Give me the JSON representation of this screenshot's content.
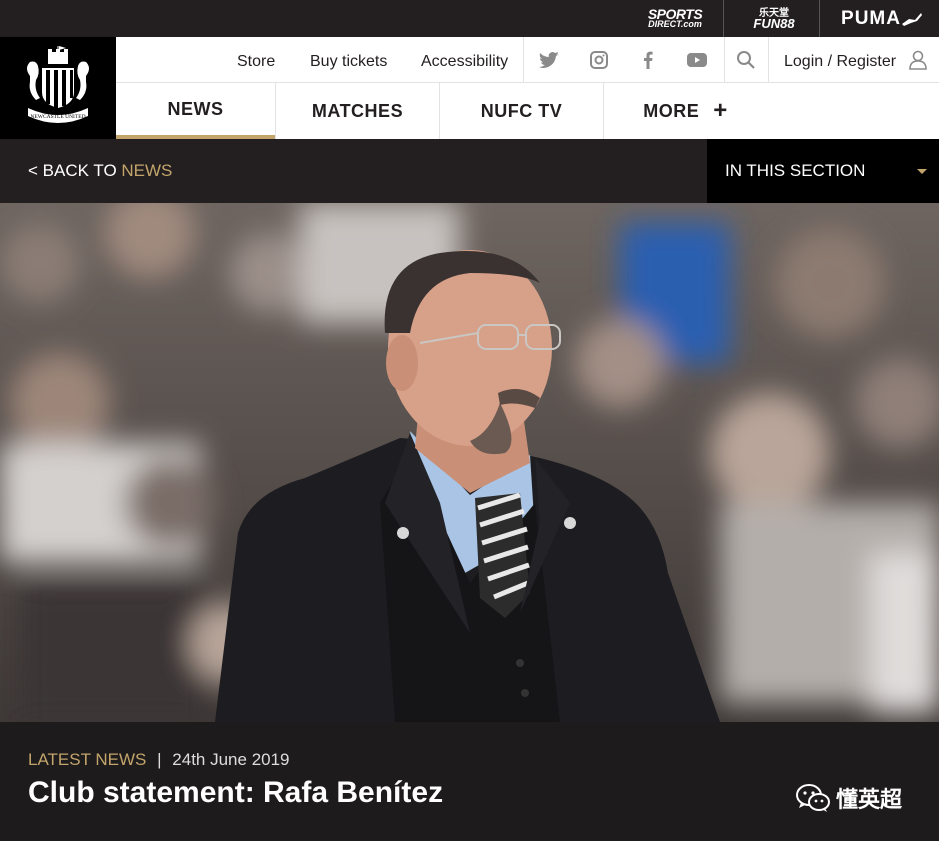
{
  "sponsors": {
    "sports_direct_line1": "SPORTS",
    "sports_direct_line2": "DIRECT.com",
    "fun88_line1": "乐天堂",
    "fun88_line2": "FUN88",
    "puma": "PUMA"
  },
  "util_nav": {
    "store": "Store",
    "buy_tickets": "Buy tickets",
    "accessibility": "Accessibility",
    "login": "Login / Register"
  },
  "main_nav": {
    "news": "NEWS",
    "matches": "MATCHES",
    "nufc_tv": "NUFC TV",
    "more": "MORE",
    "more_icon": "+"
  },
  "section_bar": {
    "back_prefix": "< BACK TO ",
    "back_target": "NEWS",
    "in_this_section": "IN THIS SECTION"
  },
  "article": {
    "category": "LATEST NEWS",
    "separator": "|",
    "date": "24th June 2019",
    "title": "Club statement: Rafa Benítez"
  },
  "watermark": {
    "text": "懂英超"
  },
  "colors": {
    "gold": "#c3a56b",
    "dark": "#231f20",
    "black": "#000000"
  }
}
